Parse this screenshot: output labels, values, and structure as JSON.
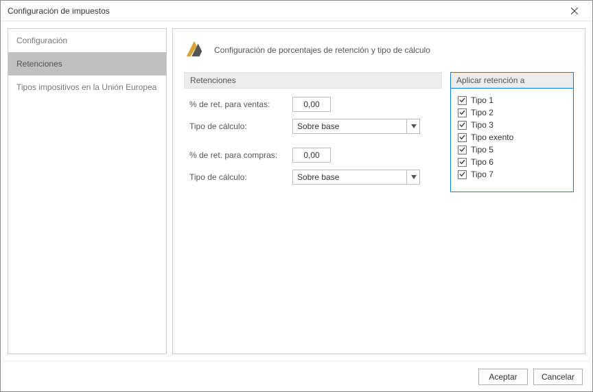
{
  "window": {
    "title": "Configuración de impuestos"
  },
  "sidebar": {
    "items": [
      {
        "label": "Configuración"
      },
      {
        "label": "Retenciones"
      },
      {
        "label": "Tipos impositivos en la Unión Europea"
      }
    ],
    "selected": 1
  },
  "header": {
    "subtitle": "Configuración de porcentajes de retención y tipo de cálculo"
  },
  "groups": {
    "retenciones": "Retenciones",
    "aplicar": "Aplicar retención a"
  },
  "form": {
    "ret_ventas_label": "% de ret. para ventas:",
    "ret_ventas_value": "0,00",
    "tipo_calc_label_1": "Tipo de cálculo:",
    "tipo_calc_value_1": "Sobre base",
    "ret_compras_label": "% de ret. para compras:",
    "ret_compras_value": "0,00",
    "tipo_calc_label_2": "Tipo de cálculo:",
    "tipo_calc_value_2": "Sobre base"
  },
  "checkboxes": [
    {
      "label": "Tipo 1",
      "checked": true
    },
    {
      "label": "Tipo 2",
      "checked": true
    },
    {
      "label": "Tipo 3",
      "checked": true
    },
    {
      "label": "Tipo exento",
      "checked": true
    },
    {
      "label": "Tipo 5",
      "checked": true
    },
    {
      "label": "Tipo 6",
      "checked": true
    },
    {
      "label": "Tipo 7",
      "checked": true
    }
  ],
  "buttons": {
    "ok": "Aceptar",
    "cancel": "Cancelar"
  }
}
